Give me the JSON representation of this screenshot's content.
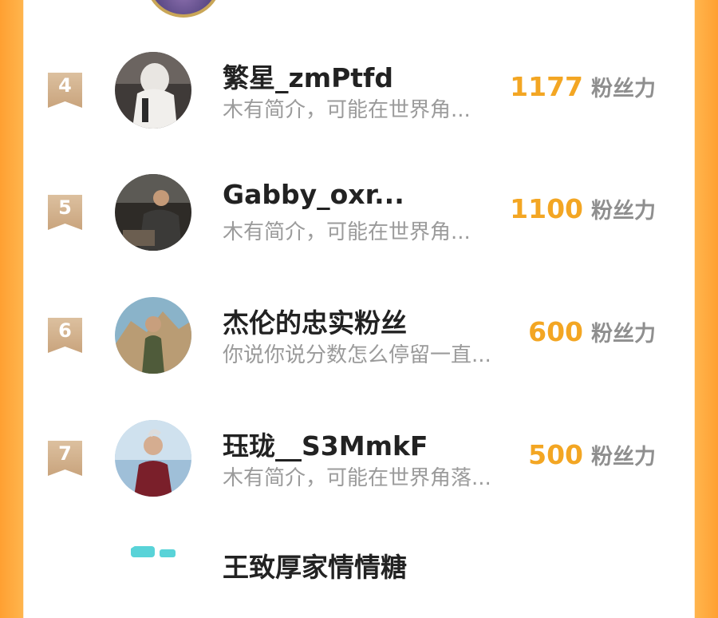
{
  "entries": [
    {
      "rank": "4",
      "name": "繁星_zmPtfd",
      "bio": "木有简介，可能在世界角...",
      "score": "1177",
      "unit": "粉丝力"
    },
    {
      "rank": "5",
      "name": "Gabby_oxr...",
      "bio": "木有简介，可能在世界角...",
      "score": "1100",
      "unit": "粉丝力"
    },
    {
      "rank": "6",
      "name": "杰伦的忠实粉丝",
      "bio": "你说你说分数怎么停留一直...",
      "score": "600",
      "unit": "粉丝力"
    },
    {
      "rank": "7",
      "name": "珏珑__S3MmkF",
      "bio": "木有简介，可能在世界角落...",
      "score": "500",
      "unit": "粉丝力"
    }
  ],
  "partial_next": {
    "name": "王致厚家情情糖"
  },
  "colors": {
    "accent": "#f3a623",
    "badge": "#d4b391",
    "frame": "#ffa032"
  }
}
